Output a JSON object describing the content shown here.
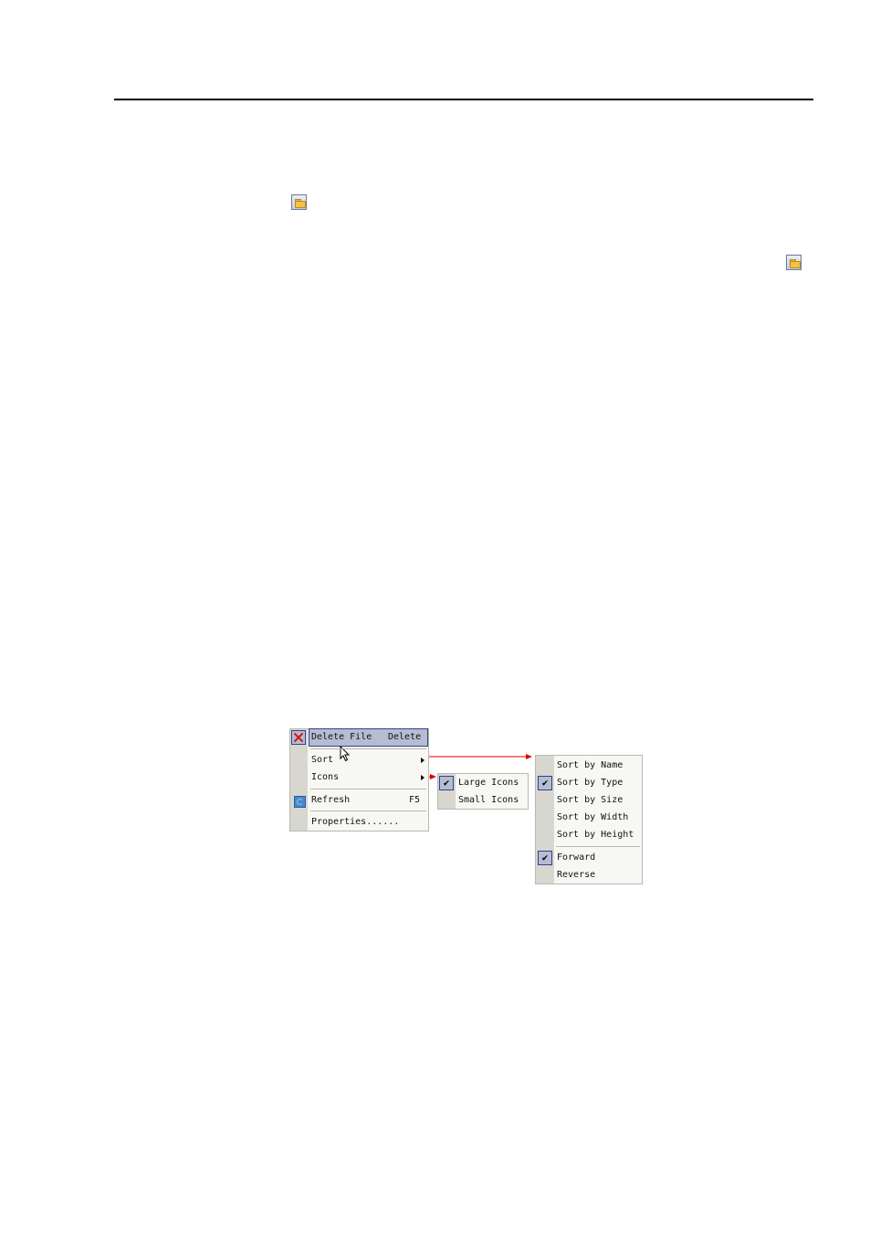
{
  "page": {
    "icons": [
      "folder-open-icon",
      "folder-open-icon"
    ]
  },
  "context_menu": {
    "items": [
      {
        "label": "Delete File",
        "shortcut": "Delete",
        "icon": "delete-x-icon",
        "highlighted": true
      },
      {
        "label": "Sort",
        "submenu": true
      },
      {
        "label": "Icons",
        "submenu": true
      },
      {
        "label": "Refresh",
        "shortcut": "F5",
        "icon": "refresh-icon"
      },
      {
        "label": "Properties......"
      }
    ]
  },
  "icons_submenu": {
    "items": [
      {
        "label": "Large Icons",
        "checked": true
      },
      {
        "label": "Small Icons",
        "checked": false
      }
    ]
  },
  "sort_submenu": {
    "items": [
      {
        "label": "Sort by Name",
        "checked": false
      },
      {
        "label": "Sort by Type",
        "checked": true
      },
      {
        "label": "Sort by Size",
        "checked": false
      },
      {
        "label": "Sort by Width",
        "checked": false
      },
      {
        "label": "Sort by Height",
        "checked": false
      },
      {
        "label": "Forward",
        "checked": true
      },
      {
        "label": "Reverse",
        "checked": false
      }
    ]
  },
  "colors": {
    "connector_arrow": "#e00000",
    "highlight": "#b6bdd2",
    "gutter": "#d8d7cf"
  }
}
